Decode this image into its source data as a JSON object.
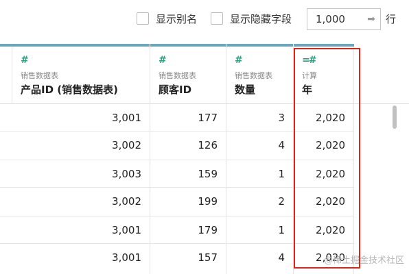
{
  "toolbar": {
    "show_alias_label": "显示别名",
    "show_hidden_label": "显示隐藏字段",
    "rows_value": "1,000",
    "rows_suffix": "行"
  },
  "columns": [
    {
      "source": "",
      "name": "",
      "type_icon": ""
    },
    {
      "source": "销售数据表",
      "name": "产品ID (销售数据表)",
      "type_icon": "#"
    },
    {
      "source": "销售数据表",
      "name": "顾客ID",
      "type_icon": "#"
    },
    {
      "source": "销售数据表",
      "name": "数量",
      "type_icon": "#"
    },
    {
      "source": "计算",
      "name": "年",
      "type_icon": "=#"
    }
  ],
  "rows": [
    [
      "3,001",
      "177",
      "3",
      "2,020"
    ],
    [
      "3,002",
      "126",
      "4",
      "2,020"
    ],
    [
      "3,003",
      "159",
      "1",
      "2,020"
    ],
    [
      "3,002",
      "199",
      "2",
      "2,020"
    ],
    [
      "3,001",
      "179",
      "1",
      "2,020"
    ],
    [
      "3,001",
      "157",
      "4",
      "2,020"
    ]
  ],
  "watermark": "@稀土掘金技术社区",
  "colors": {
    "accent_bar": "#6aa6bd",
    "highlight": "#e2231a",
    "type_icon": "#2e9c7d"
  }
}
